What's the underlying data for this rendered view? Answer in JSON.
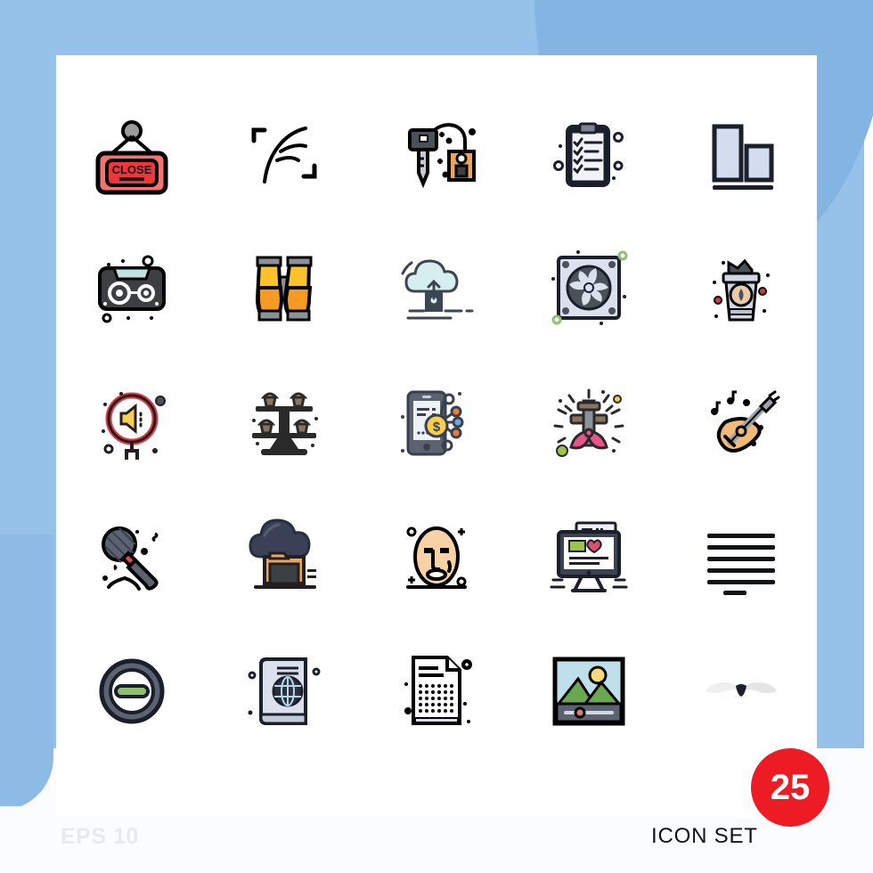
{
  "page": {
    "background_color": "#96c2e9",
    "card_color": "#ffffff",
    "footer_note": "EPS 10",
    "set_label": "ICON SET",
    "badge_count": "25",
    "badge_color": "#ed1c24",
    "badge_text_color": "#ffffff"
  },
  "grid": {
    "columns": 5,
    "rows": 5,
    "total_icons": 25
  },
  "icons": [
    {
      "row": 1,
      "col": 1,
      "name": "close-sign-icon",
      "label": "Closed hanging sign",
      "text": "CLOSE",
      "colors": [
        "#f4726f",
        "#f0353b",
        "#231f20",
        "#9b9b9b"
      ]
    },
    {
      "row": 1,
      "col": 2,
      "name": "feather-scan-icon",
      "label": "Feather inside scan frame",
      "text": "",
      "colors": [
        "#000000"
      ]
    },
    {
      "row": 1,
      "col": 3,
      "name": "key-tag-icon",
      "label": "Key with price tag",
      "text": "",
      "colors": [
        "#4b5159",
        "#c7ccd4",
        "#e8a661",
        "#000000"
      ]
    },
    {
      "row": 1,
      "col": 4,
      "name": "clipboard-checklist-icon",
      "label": "Clipboard checklist",
      "text": "",
      "colors": [
        "#f1f3f7",
        "#1b1e2b",
        "#7d8493"
      ]
    },
    {
      "row": 1,
      "col": 5,
      "name": "bar-chart-icon",
      "label": "Two bar columns chart",
      "text": "",
      "colors": [
        "#d4dcf0",
        "#1b1e2b"
      ]
    },
    {
      "row": 2,
      "col": 1,
      "name": "cassette-tape-icon",
      "label": "Audio cassette tape",
      "text": "",
      "colors": [
        "#3c4043",
        "#bfe3e0",
        "#ffffff",
        "#000000"
      ]
    },
    {
      "row": 2,
      "col": 2,
      "name": "binoculars-icon",
      "label": "Binoculars",
      "text": "",
      "colors": [
        "#fcc22d",
        "#f59a23",
        "#8c9199",
        "#000000"
      ]
    },
    {
      "row": 2,
      "col": 3,
      "name": "cloud-upload-icon",
      "label": "Cloud upload server",
      "text": "",
      "colors": [
        "#d6eef0",
        "#3c4552",
        "#8c9199"
      ]
    },
    {
      "row": 2,
      "col": 4,
      "name": "cooling-fan-icon",
      "label": "Computer cooling fan",
      "text": "",
      "colors": [
        "#dbe1ec",
        "#4b5159",
        "#8fbf6f"
      ]
    },
    {
      "row": 2,
      "col": 5,
      "name": "coffee-cup-icon",
      "label": "Takeaway coffee cup",
      "text": "",
      "colors": [
        "#cfd8e4",
        "#e8c9a8",
        "#4b5159",
        "#d53b3b"
      ]
    },
    {
      "row": 3,
      "col": 1,
      "name": "megaphone-signal-icon",
      "label": "Loudspeaker signal",
      "text": "",
      "colors": [
        "#e03b42",
        "#f5cf4f",
        "#231f20"
      ]
    },
    {
      "row": 3,
      "col": 2,
      "name": "cupcake-stand-icon",
      "label": "Tiered cupcake stand",
      "text": "",
      "colors": [
        "#2a2a2a",
        "#8a7561",
        "#d9cbb9"
      ]
    },
    {
      "row": 3,
      "col": 3,
      "name": "mobile-payment-icon",
      "label": "Mobile money sharing",
      "text": "",
      "colors": [
        "#5b6370",
        "#f5cf4f",
        "#e87f3a",
        "#6fa8d8"
      ]
    },
    {
      "row": 3,
      "col": 4,
      "name": "celebration-bow-icon",
      "label": "Decorated pole with bow",
      "text": "",
      "colors": [
        "#e8538a",
        "#8a7561",
        "#9bc44d",
        "#e8d24d"
      ]
    },
    {
      "row": 3,
      "col": 5,
      "name": "acoustic-guitar-icon",
      "label": "Acoustic guitar with notes",
      "text": "",
      "colors": [
        "#f0b979",
        "#9ba3ad",
        "#000000"
      ]
    },
    {
      "row": 4,
      "col": 1,
      "name": "microphone-icon",
      "label": "Handheld microphone",
      "text": "",
      "colors": [
        "#5b6370",
        "#e04a4a",
        "#000000"
      ]
    },
    {
      "row": 4,
      "col": 2,
      "name": "burning-house-icon",
      "label": "House with smoke cloud",
      "text": "",
      "colors": [
        "#3a4055",
        "#e8a661",
        "#3c4043"
      ]
    },
    {
      "row": 4,
      "col": 3,
      "name": "face-mask-icon",
      "label": "Theatre face mask",
      "text": "",
      "colors": [
        "#f7d2a6",
        "#000000"
      ]
    },
    {
      "row": 4,
      "col": 4,
      "name": "desktop-webpage-icon",
      "label": "Desktop monitor webpage",
      "text": "",
      "colors": [
        "#3c4252",
        "#9bc44d",
        "#d9516b",
        "#ffffff"
      ]
    },
    {
      "row": 4,
      "col": 5,
      "name": "text-justify-icon",
      "label": "Justify text alignment",
      "text": "",
      "colors": [
        "#000000"
      ]
    },
    {
      "row": 5,
      "col": 1,
      "name": "minus-circle-icon",
      "label": "Remove minus button",
      "text": "",
      "colors": [
        "#5b6370",
        "#8fbf6f",
        "#000000"
      ]
    },
    {
      "row": 5,
      "col": 2,
      "name": "passport-icon",
      "label": "Passport with globe",
      "text": "",
      "colors": [
        "#dbe1ec",
        "#2a3040",
        "#b9d7e8"
      ]
    },
    {
      "row": 5,
      "col": 3,
      "name": "document-braille-icon",
      "label": "Document with dot grid",
      "text": "",
      "colors": [
        "#ffffff",
        "#000000",
        "#d8dde5"
      ]
    },
    {
      "row": 5,
      "col": 4,
      "name": "image-slider-icon",
      "label": "Photo with slider control",
      "text": "",
      "colors": [
        "#bfe0ea",
        "#6aa84f",
        "#f5d97a",
        "#5b6370"
      ]
    },
    {
      "row": 5,
      "col": 5,
      "name": "mustache-icon",
      "label": "Mustache",
      "text": "",
      "colors": [
        "#1b1e2b",
        "#eeeeee"
      ]
    }
  ]
}
